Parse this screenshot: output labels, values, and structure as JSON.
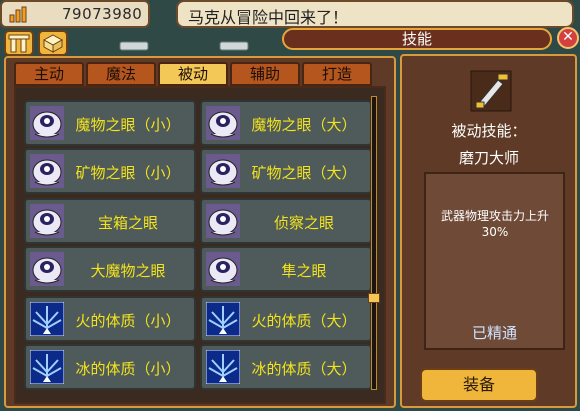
{
  "header": {
    "gold": "79073980",
    "message": "马克从冒险中回来了！"
  },
  "window": {
    "title": "技能",
    "close_glyph": "✕"
  },
  "tabs": [
    {
      "label": "主动",
      "active": false
    },
    {
      "label": "魔法",
      "active": false
    },
    {
      "label": "被动",
      "active": true
    },
    {
      "label": "辅助",
      "active": false
    },
    {
      "label": "打造",
      "active": false
    }
  ],
  "skills": [
    {
      "label": "魔物之眼（小）",
      "icon": "monster-eye-icon"
    },
    {
      "label": "魔物之眼（大）",
      "icon": "monster-eye-icon"
    },
    {
      "label": "矿物之眼（小）",
      "icon": "monster-eye-icon"
    },
    {
      "label": "矿物之眼（大）",
      "icon": "monster-eye-icon"
    },
    {
      "label": "宝箱之眼",
      "icon": "monster-eye-icon"
    },
    {
      "label": "侦察之眼",
      "icon": "monster-eye-icon"
    },
    {
      "label": "大魔物之眼",
      "icon": "monster-eye-icon"
    },
    {
      "label": "隼之眼",
      "icon": "monster-eye-icon"
    },
    {
      "label": "火的体质（小）",
      "icon": "constitution-icon"
    },
    {
      "label": "火的体质（大）",
      "icon": "constitution-icon"
    },
    {
      "label": "冰的体质（小）",
      "icon": "constitution-icon"
    },
    {
      "label": "冰的体质（大）",
      "icon": "constitution-icon"
    }
  ],
  "detail": {
    "type_label": "被动技能：",
    "name": "磨刀大师",
    "description": "武器物理攻击力上升30%",
    "status": "已精通",
    "equip_label": "装备"
  },
  "colors": {
    "label": "#f2e31c",
    "panel": "#5f3a26",
    "border": "#d79a3c",
    "active_tab": "#f4c857",
    "tab": "#b5561e"
  }
}
